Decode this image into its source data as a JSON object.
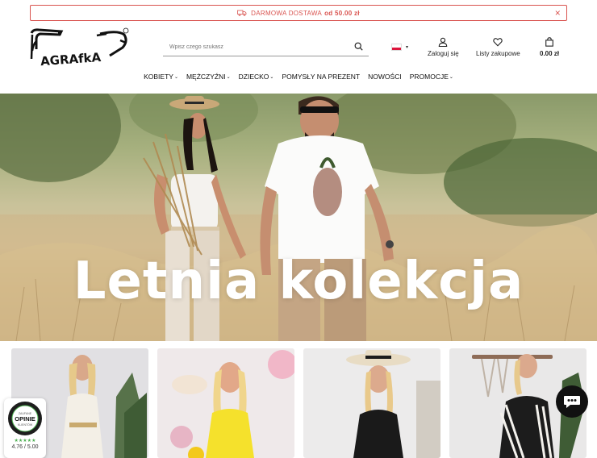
{
  "promo": {
    "text": "DARMOWA DOSTAWA",
    "amount": "od 50.00 zł",
    "close_glyph": "×",
    "color": "#d9534f"
  },
  "header": {
    "logo_alt": "AgrAfka",
    "search_placeholder": "Wpisz czego szukasz",
    "language_flag": "pl-flag-icon",
    "login_label": "Zaloguj się",
    "wishlist_label": "Listy zakupowe",
    "cart_total": "0.00 zł"
  },
  "nav": {
    "items": [
      {
        "label": "KOBIETY",
        "dropdown": true
      },
      {
        "label": "MĘŻCZYŹNI",
        "dropdown": true
      },
      {
        "label": "DZIECKO",
        "dropdown": true
      },
      {
        "label": "POMYSŁY NA PREZENT",
        "dropdown": false
      },
      {
        "label": "NOWOŚCI",
        "dropdown": false
      },
      {
        "label": "PROMOCJE",
        "dropdown": true
      }
    ]
  },
  "hero": {
    "headline": "Letnia kolekcja"
  },
  "cards": [
    {
      "icon": "woman-lace-dress-photo"
    },
    {
      "icon": "woman-yellow-top-photo"
    },
    {
      "icon": "woman-black-top-hat-photo"
    },
    {
      "icon": "woman-striped-jacket-photo"
    }
  ],
  "badge": {
    "line1": "ZAUFANE",
    "line2": "OPINIE",
    "line3": "KLIENTÓW",
    "stars": "★★★★★",
    "score": "4.76 / 5.00"
  },
  "chat": {
    "icon": "chat-bubble-icon"
  }
}
